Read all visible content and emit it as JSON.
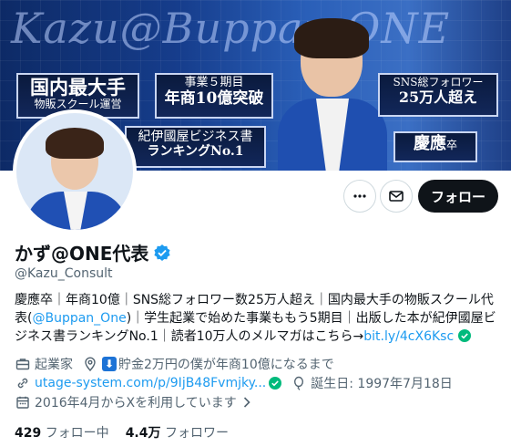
{
  "banner": {
    "wordmark": "Kazu@Buppan ONE",
    "box1": {
      "big": "国内最大手",
      "small": "物販スクール運営"
    },
    "box2": {
      "small": "事業５期目",
      "big": "年商10億突破"
    },
    "box3": {
      "small": "SNS総フォロワー",
      "big": "25万人超え"
    },
    "box4": {
      "small": "紀伊國屋ビジネス書",
      "big": "ランキングNo.1"
    },
    "box5": {
      "big": "慶應",
      "small": "卒"
    }
  },
  "actions": {
    "follow_label": "フォロー"
  },
  "profile": {
    "display_name": "かず@ONE代表",
    "handle": "@Kazu_Consult",
    "bio_part1": "慶應卒｜年商10億｜SNS総フォロワー数25万人超え｜国内最大手の物販スクール代表(",
    "bio_mention": "@Buppan_One",
    "bio_part2": ")｜学生起業で始めた事業ももう5期目｜出版した本が紀伊國屋ビジネス書ランキングNo.1｜読者10万人のメルマガはこちら→",
    "bio_link": "bit.ly/4cX6Ksc",
    "category": "起業家",
    "location": "貯金2万円の僕が年商10億になるまで",
    "website": "utage-system.com/p/9IjB48Fvmjky...",
    "birthday": "誕生日: 1997年7月18日",
    "joined": "2016年4月からXを利用しています"
  },
  "stats": {
    "following_count": "429",
    "following_label": "フォロー中",
    "followers_count": "4.4万",
    "followers_label": "フォロワー"
  },
  "colors": {
    "accent": "#1d9bf0",
    "text": "#0f1419",
    "muted": "#536471",
    "verified_badge": "#1d9bf0",
    "verified_link": "#00ba7c"
  }
}
